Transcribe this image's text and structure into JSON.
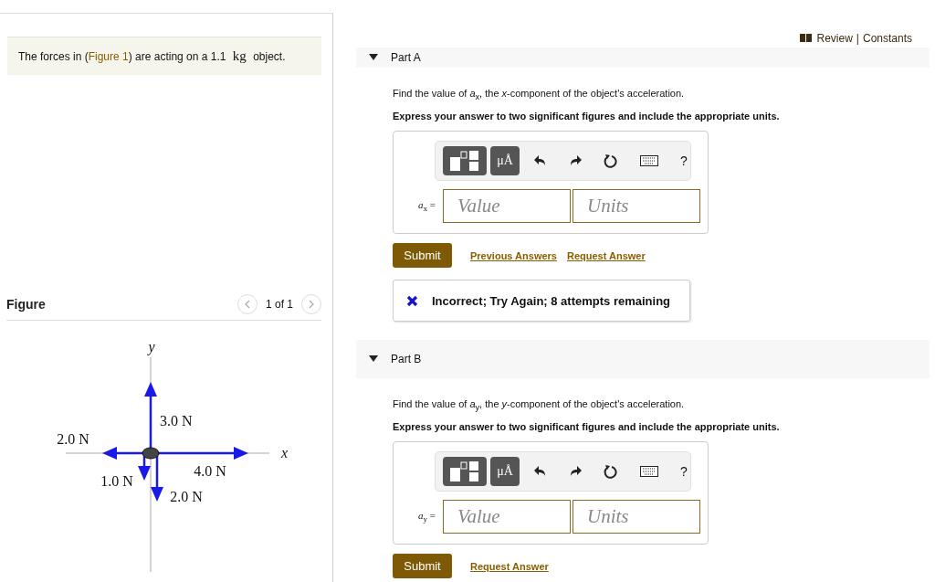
{
  "problem": {
    "before": "The forces in (",
    "link": "Figure 1",
    "after": ") are acting on a 1.1 ",
    "unit": "kg",
    "end": " object."
  },
  "figure": {
    "title": "Figure",
    "pager": "1 of 1",
    "axis_x": "x",
    "axis_y": "y",
    "forces": [
      {
        "label": "3.0 N"
      },
      {
        "label": "2.0 N"
      },
      {
        "label": "4.0 N"
      },
      {
        "label": "1.0 N"
      },
      {
        "label": "2.0 N"
      }
    ]
  },
  "header_links": {
    "items": [
      "Review",
      "Constants"
    ],
    "separator": "|"
  },
  "parts": [
    {
      "title": "Part A",
      "expanded": true,
      "question": "Find the value of *a*$_{x}$, the *x*-component of the object's acceleration.",
      "instruction": "Express your answer to two significant figures and include the appropriate units.",
      "units_glyph": "μÅ",
      "help": "?",
      "variable": "*a*$_{x}$ =",
      "value_placeholder": "Value",
      "units_placeholder": "Units",
      "submit": "Submit",
      "links": [
        "Previous Answers",
        "Request Answer"
      ],
      "feedback": "Incorrect; Try Again; 8 attempts remaining"
    },
    {
      "title": "Part B",
      "expanded": true,
      "question": "Find the value of *a*$_{y}$, the *y*-component of the object's acceleration.",
      "instruction": "Express your answer to two significant figures and include the appropriate units.",
      "units_glyph": "μÅ",
      "help": "?",
      "variable": "*a*$_{y}$ =",
      "value_placeholder": "Value",
      "units_placeholder": "Units",
      "submit": "Submit",
      "links": [
        "Request Answer"
      ]
    }
  ]
}
